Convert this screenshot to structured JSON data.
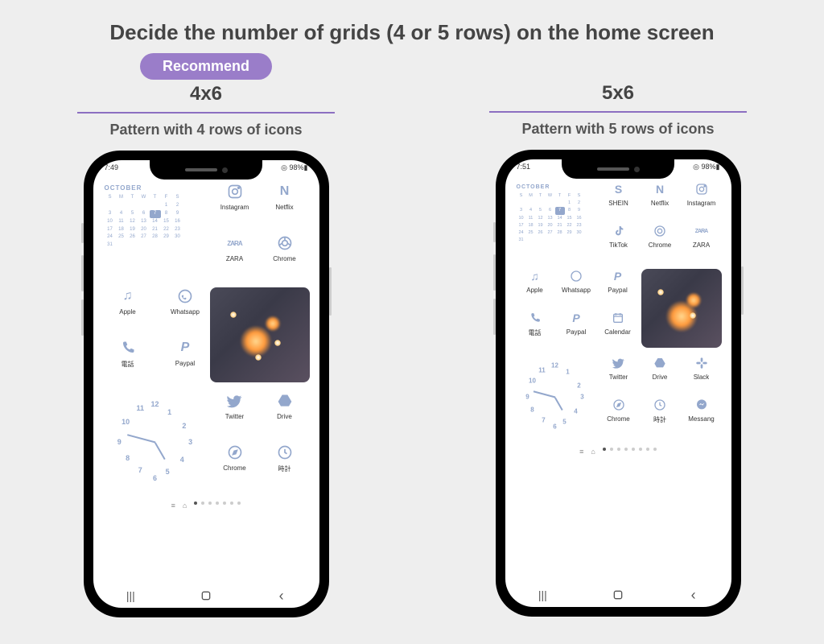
{
  "title": "Decide the number of grids (4 or 5 rows) on the home screen",
  "recommend": "Recommend",
  "columns": {
    "left": {
      "grid": "4x6",
      "pattern": "Pattern with 4 rows of icons",
      "status_time": "7:49",
      "status_right": "◎ 98%▮"
    },
    "right": {
      "grid": "5x6",
      "pattern": "Pattern with 5 rows of icons",
      "status_time": "7:51",
      "status_right": "◎ 98%▮"
    }
  },
  "calendar": {
    "month": "OCTOBER",
    "days": [
      "S",
      "M",
      "T",
      "W",
      "T",
      "F",
      "S"
    ],
    "weeks": [
      [
        "",
        "",
        "",
        "",
        "",
        "1",
        "2"
      ],
      [
        "3",
        "4",
        "5",
        "6",
        "7",
        "8",
        "9"
      ],
      [
        "10",
        "11",
        "12",
        "13",
        "14",
        "15",
        "16"
      ],
      [
        "17",
        "18",
        "19",
        "20",
        "21",
        "22",
        "23"
      ],
      [
        "24",
        "25",
        "26",
        "27",
        "28",
        "29",
        "30"
      ],
      [
        "31",
        "",
        "",
        "",
        "",
        "",
        ""
      ]
    ],
    "today": "7"
  },
  "icons4": {
    "r1": [
      {
        "n": "Instagram",
        "i": "instagram"
      },
      {
        "n": "Netflix",
        "i": "netflix"
      }
    ],
    "r2": [
      {
        "n": "ZARA",
        "i": "zara"
      },
      {
        "n": "Chrome",
        "i": "chrome"
      }
    ],
    "r3": [
      {
        "n": "Apple",
        "i": "music"
      },
      {
        "n": "Whatsapp",
        "i": "whatsapp"
      }
    ],
    "r4": [
      {
        "n": "電話",
        "i": "phone"
      },
      {
        "n": "Paypal",
        "i": "paypal"
      }
    ],
    "r5": [
      {
        "n": "Twitter",
        "i": "twitter"
      },
      {
        "n": "Drive",
        "i": "drive"
      }
    ],
    "r6": [
      {
        "n": "Chrome",
        "i": "compass"
      },
      {
        "n": "時計",
        "i": "clock"
      }
    ]
  },
  "icons5": {
    "r1": [
      {
        "n": "SHEIN",
        "i": "shein"
      },
      {
        "n": "Netflix",
        "i": "netflix"
      },
      {
        "n": "Instagram",
        "i": "instagram"
      }
    ],
    "r2": [
      {
        "n": "TikTok",
        "i": "tiktok"
      },
      {
        "n": "Chrome",
        "i": "chrome"
      },
      {
        "n": "ZARA",
        "i": "zara"
      }
    ],
    "r3": [
      {
        "n": "Apple",
        "i": "music"
      },
      {
        "n": "Whatsapp",
        "i": "whatsapp"
      },
      {
        "n": "Paypal",
        "i": "paypal"
      }
    ],
    "r4": [
      {
        "n": "電話",
        "i": "phone"
      },
      {
        "n": "Paypal",
        "i": "paypal"
      },
      {
        "n": "Calendar",
        "i": "calendar"
      }
    ],
    "r5": [
      {
        "n": "Twitter",
        "i": "twitter"
      },
      {
        "n": "Drive",
        "i": "drive"
      },
      {
        "n": "Slack",
        "i": "slack"
      }
    ],
    "r6": [
      {
        "n": "Chrome",
        "i": "compass"
      },
      {
        "n": "時計",
        "i": "clock"
      },
      {
        "n": "Messang",
        "i": "messenger"
      }
    ]
  },
  "nav": {
    "recents": "|||",
    "home": "◯",
    "back": "‹"
  }
}
